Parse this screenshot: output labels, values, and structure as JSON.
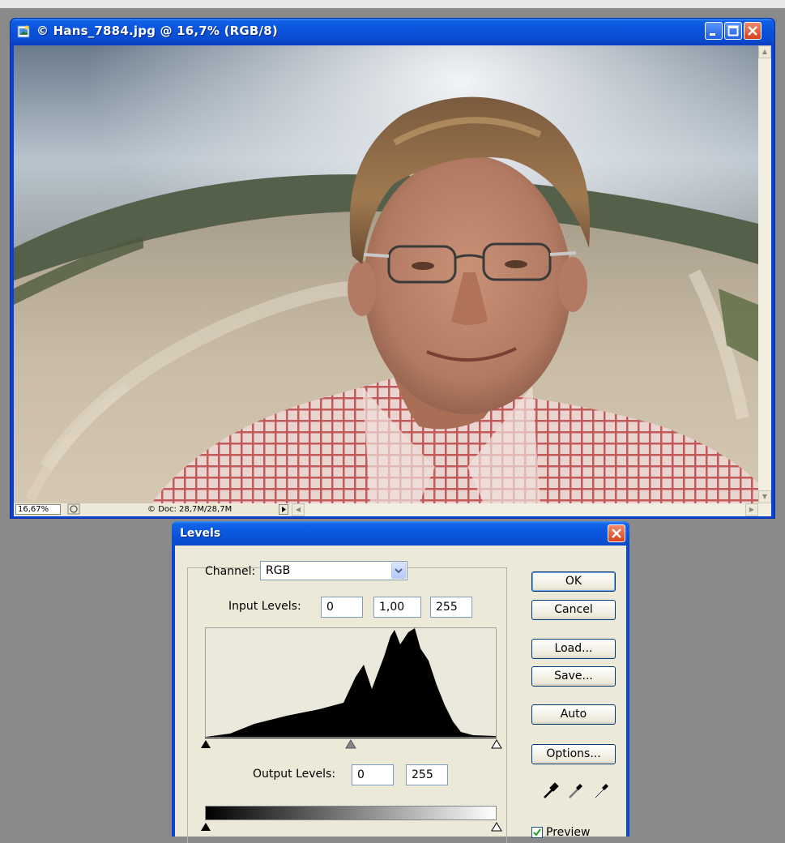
{
  "document_window": {
    "title": "© Hans_7884.jpg @ 16,7% (RGB/8)",
    "status": {
      "zoom": "16,67%",
      "doc_size": "Doc: 28,7M/28,7M"
    }
  },
  "levels_dialog": {
    "title": "Levels",
    "channel_label": "Channel:",
    "channel_value": "RGB",
    "input_levels_label": "Input Levels:",
    "input_black": "0",
    "input_gamma": "1,00",
    "input_white": "255",
    "output_levels_label": "Output Levels:",
    "output_black": "0",
    "output_white": "255",
    "buttons": {
      "ok": "OK",
      "cancel": "Cancel",
      "load": "Load...",
      "save": "Save...",
      "auto": "Auto",
      "options": "Options..."
    },
    "preview_label": "Preview",
    "preview_checked": true
  },
  "colors": {
    "xp_title_blue": "#0a52d8",
    "dialog_bg": "#ece9d8"
  }
}
